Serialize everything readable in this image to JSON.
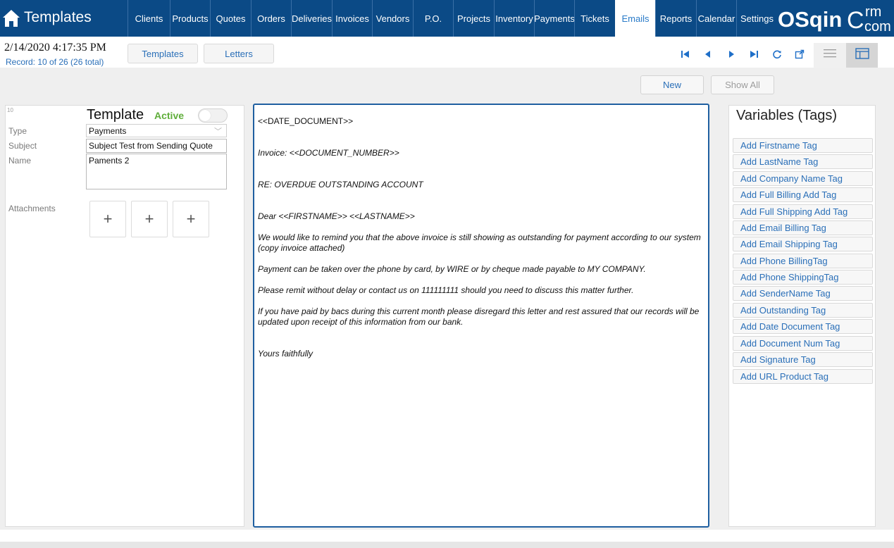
{
  "app": {
    "title": "Templates"
  },
  "nav": {
    "items": [
      {
        "label": "Clients"
      },
      {
        "label": "Products"
      },
      {
        "label": "Quotes"
      },
      {
        "label": "Orders"
      },
      {
        "label": "Deliveries"
      },
      {
        "label": "Invoices"
      },
      {
        "label": "Vendors"
      },
      {
        "label": "P.O."
      },
      {
        "label": "Projects"
      },
      {
        "label": "Inventory"
      },
      {
        "label": "Payments"
      },
      {
        "label": "Tickets"
      },
      {
        "label": "Emails"
      },
      {
        "label": "Reports"
      },
      {
        "label": "Calendar"
      },
      {
        "label": "Settings"
      }
    ],
    "active": "Emails"
  },
  "logo": {
    "text_main": "OSqin",
    "text_c": "C",
    "text_rm": "rm",
    "text_com": "com"
  },
  "header": {
    "datetime": "2/14/2020 4:17:35 PM",
    "record": "Record:  10 of 26 (26 total)",
    "tabs": [
      "Templates",
      "Letters"
    ]
  },
  "actions": {
    "new": "New",
    "show_all": "Show All"
  },
  "form": {
    "record_number": "10",
    "title": "Template",
    "status": "Active",
    "type_label": "Type",
    "type_value": "Payments",
    "subject_label": "Subject",
    "subject_value": "Subject Test from Sending Quote",
    "name_label": "Name",
    "name_value": "Paments 2",
    "attachments_label": "Attachments",
    "attach_plus": "+"
  },
  "editor": {
    "lines": [
      "<<DATE_DOCUMENT>>",
      "Invoice: <<DOCUMENT_NUMBER>>",
      "RE: OVERDUE OUTSTANDING ACCOUNT",
      "Dear <<FIRSTNAME>> <<LASTNAME>>",
      "We would like to remind you that the above invoice is still showing as outstanding for payment according to our system (copy invoice attached)",
      "Payment can be taken over the phone by card, by WIRE or by cheque made payable to MY COMPANY.",
      "Please remit without delay or contact us on 111111111 should you need to discuss this matter further.",
      "If you have paid by bacs during this current month please disregard this letter and rest assured that our records will be updated upon receipt of this information from our bank.",
      "Yours faithfully"
    ]
  },
  "variables": {
    "title": "Variables (Tags)",
    "tags": [
      "Add Firstname Tag",
      "Add LastName Tag",
      "Add Company Name Tag",
      "Add Full Billing Add Tag",
      "Add Full Shipping Add Tag",
      "Add Email Billing Tag",
      "Add Email Shipping Tag",
      "Add Phone BillingTag",
      "Add Phone ShippingTag",
      "Add SenderName Tag",
      "Add Outstanding Tag",
      "Add Date Document Tag",
      "Add Document Num Tag",
      "Add Signature Tag",
      "Add URL Product Tag"
    ]
  },
  "colors": {
    "nav_bg": "#0b4a86",
    "accent": "#2a6fb8",
    "active_green": "#5fae3a"
  }
}
